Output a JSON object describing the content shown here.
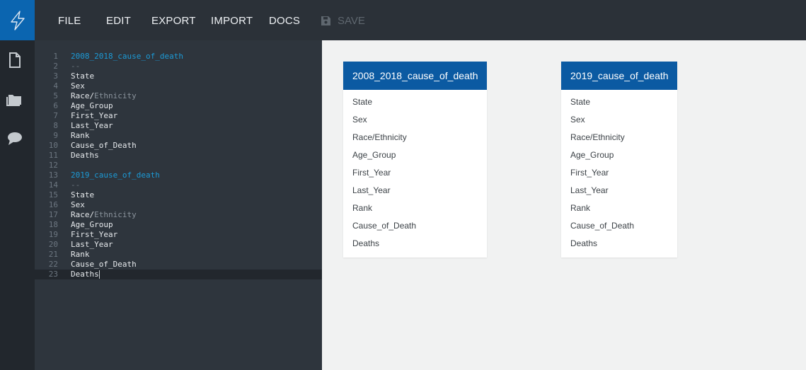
{
  "menu": {
    "file": "FILE",
    "edit": "EDIT",
    "export": "EXPORT",
    "import": "IMPORT",
    "docs": "DOCS",
    "save": "SAVE"
  },
  "editor": {
    "lines": [
      {
        "n": "1",
        "text": "2008_2018_cause_of_death"
      },
      {
        "n": "2",
        "text": "--"
      },
      {
        "n": "3",
        "text": "State"
      },
      {
        "n": "4",
        "text": "Sex"
      },
      {
        "n": "5",
        "pre": "Race/",
        "post": "Ethnicity"
      },
      {
        "n": "6",
        "text": "Age_Group"
      },
      {
        "n": "7",
        "text": "First_Year"
      },
      {
        "n": "8",
        "text": "Last_Year"
      },
      {
        "n": "9",
        "text": "Rank"
      },
      {
        "n": "10",
        "text": "Cause_of_Death"
      },
      {
        "n": "11",
        "text": "Deaths"
      },
      {
        "n": "12",
        "text": ""
      },
      {
        "n": "13",
        "text": "2019_cause_of_death"
      },
      {
        "n": "14",
        "text": "--"
      },
      {
        "n": "15",
        "text": "State"
      },
      {
        "n": "16",
        "text": "Sex"
      },
      {
        "n": "17",
        "pre": "Race/",
        "post": "Ethnicity"
      },
      {
        "n": "18",
        "text": "Age_Group"
      },
      {
        "n": "19",
        "text": "First_Year"
      },
      {
        "n": "20",
        "text": "Last_Year"
      },
      {
        "n": "21",
        "text": "Rank"
      },
      {
        "n": "22",
        "text": "Cause_of_Death"
      },
      {
        "n": "23",
        "text": "Deaths"
      }
    ]
  },
  "tables": [
    {
      "title": "2008_2018_cause_of_death",
      "fields": [
        "State",
        "Sex",
        "Race/Ethnicity",
        "Age_Group",
        "First_Year",
        "Last_Year",
        "Rank",
        "Cause_of_Death",
        "Deaths"
      ]
    },
    {
      "title": "2019_cause_of_death",
      "fields": [
        "State",
        "Sex",
        "Race/Ethnicity",
        "Age_Group",
        "First_Year",
        "Last_Year",
        "Rank",
        "Cause_of_Death",
        "Deaths"
      ]
    }
  ],
  "colors": {
    "accent": "#0b65b0",
    "table_header": "#0b5aa2",
    "table_name_code": "#1c9ad6"
  }
}
